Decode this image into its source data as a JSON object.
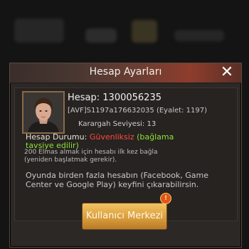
{
  "dialog": {
    "title": "Hesap Ayarları",
    "close_icon": "close-icon"
  },
  "account": {
    "id_label": "Hesap: 1300056235",
    "alliance_line": "[AVF]S1197a176632035 (Eyalet: 1197)",
    "hq_level": "Karargah Seviyesi: 13"
  },
  "status": {
    "label": "Hesap Durumu: ",
    "value": "Güvenliksiz",
    "recommend_1": " (bağlama",
    "recommend_2": "tavsiye edilir)"
  },
  "reward": {
    "line1": "200 Elmas almak için hesabı ilk kez bağla",
    "line2": "(yeniden başlatmak gerekir)."
  },
  "multi": {
    "line1": "Oyunda birden fazla hesabın (Facebook, Game",
    "line2": "Center ve Google Play) keyfini çıkarabilirsin."
  },
  "button": {
    "label": "Kullanıcı Merkezi",
    "badge": "!"
  },
  "colors": {
    "insecure": "#ff4a3a",
    "recommend": "#8fe035",
    "button": "#d79b3a"
  }
}
